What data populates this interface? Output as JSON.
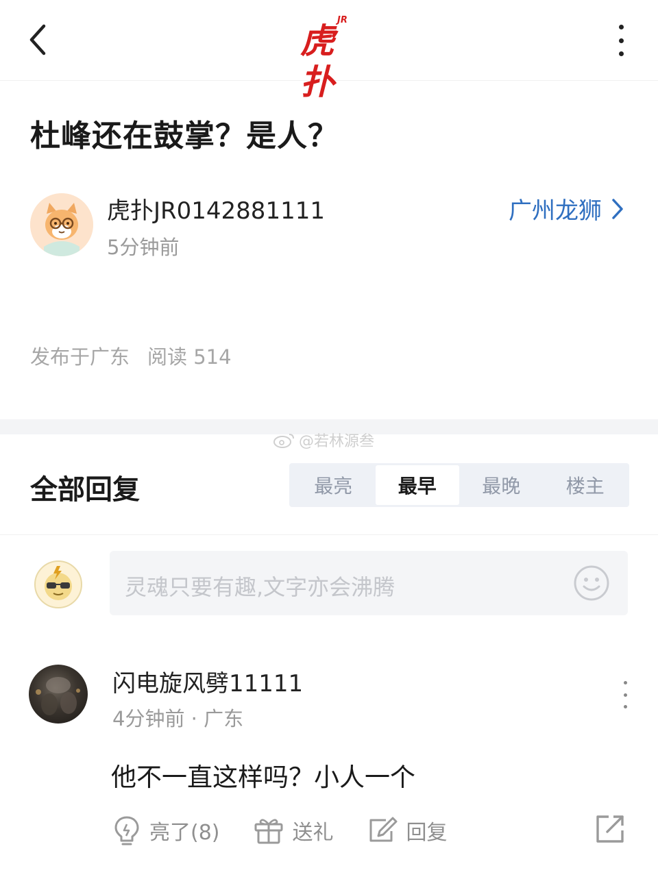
{
  "header": {
    "logo_main": "虎扑",
    "logo_sub": "JR",
    "back_icon": "chevron-left-icon",
    "more_icon": "more-vertical-icon"
  },
  "post": {
    "title": "杜峰还在鼓掌？是人？",
    "author": "虎扑JR0142881111",
    "time": "5分钟前",
    "team": "广州龙狮",
    "location": "发布于广东",
    "reads": "阅读 514"
  },
  "watermark": "@若林源叁",
  "replies": {
    "title": "全部回复",
    "tabs": [
      {
        "label": "最亮",
        "active": false
      },
      {
        "label": "最早",
        "active": true
      },
      {
        "label": "最晚",
        "active": false
      },
      {
        "label": "楼主",
        "active": false
      }
    ]
  },
  "composer": {
    "placeholder": "灵魂只要有趣,文字亦会沸腾"
  },
  "comment": {
    "name": "闪电旋风劈11111",
    "meta": "4分钟前 · 广东",
    "text": "他不一直这样吗？小人一个",
    "actions": {
      "like": "亮了(8)",
      "gift": "送礼",
      "reply": "回复"
    }
  },
  "colors": {
    "brand_red": "#d81e1e",
    "link_blue": "#2f6fc0",
    "muted": "#9a9a9a"
  }
}
